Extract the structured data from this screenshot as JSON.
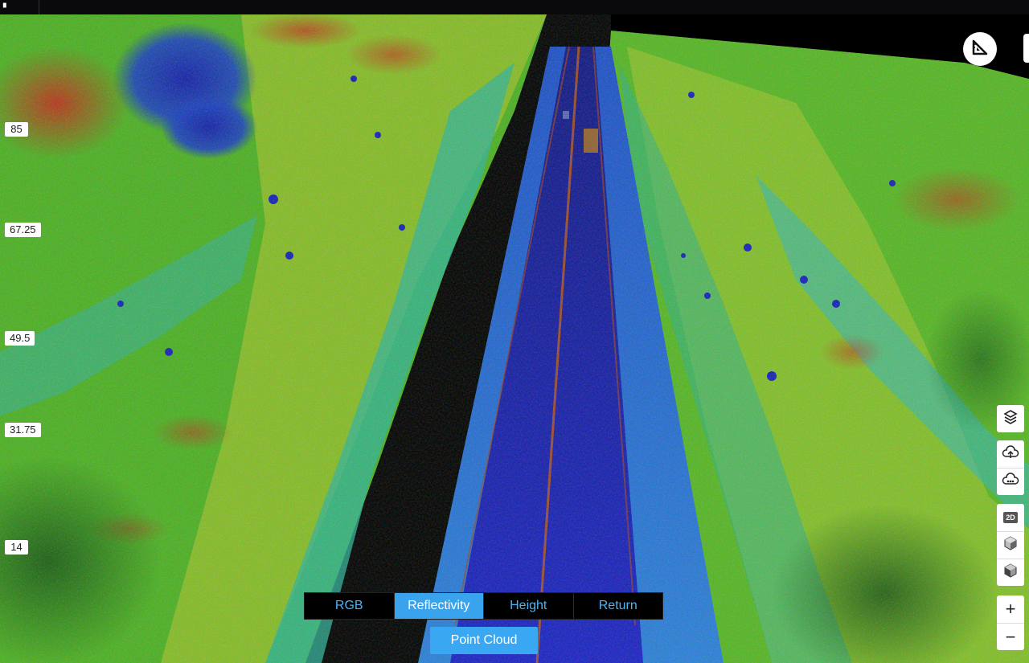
{
  "toolbar": {
    "measure_icon": "ruler-triangle-icon"
  },
  "scale": {
    "labels": [
      "85",
      "67.25",
      "49.5",
      "31.75",
      "14"
    ]
  },
  "side_controls": {
    "icons": [
      "layers-icon",
      "cloud-upload-icon",
      "cloud-settings-icon",
      "2d-view-icon",
      "3d-cube-icon",
      "3d-cube-shaded-icon",
      "zoom-in-icon",
      "zoom-out-icon"
    ],
    "view_2d_label": "2D",
    "zoom_in": "+",
    "zoom_out": "−"
  },
  "modes": {
    "tabs": [
      {
        "label": "RGB",
        "active": false
      },
      {
        "label": "Reflectivity",
        "active": true
      },
      {
        "label": "Height",
        "active": false
      },
      {
        "label": "Return",
        "active": false
      }
    ],
    "point_cloud_label": "Point Cloud"
  },
  "colors": {
    "accent": "#39a3ee",
    "road": "#1a1fb0",
    "vegetation": "#3cb81e",
    "high": "#c42a12"
  }
}
